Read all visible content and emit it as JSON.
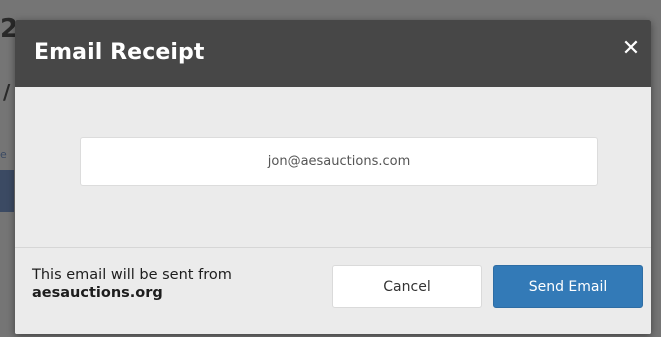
{
  "modal": {
    "title": "Email Receipt",
    "close_icon": "close-icon",
    "email_value": "jon@aesauctions.com",
    "footer_note_prefix": "This email will be sent from",
    "footer_note_domain": "aesauctions.org",
    "cancel_label": "Cancel",
    "send_label": "Send Email"
  },
  "background": {
    "glyph_top": "2",
    "glyph_mid": "/",
    "glyph_small": "e"
  },
  "colors": {
    "header": "#474747",
    "primary_button": "#337ab7",
    "overlay": "#757575"
  }
}
